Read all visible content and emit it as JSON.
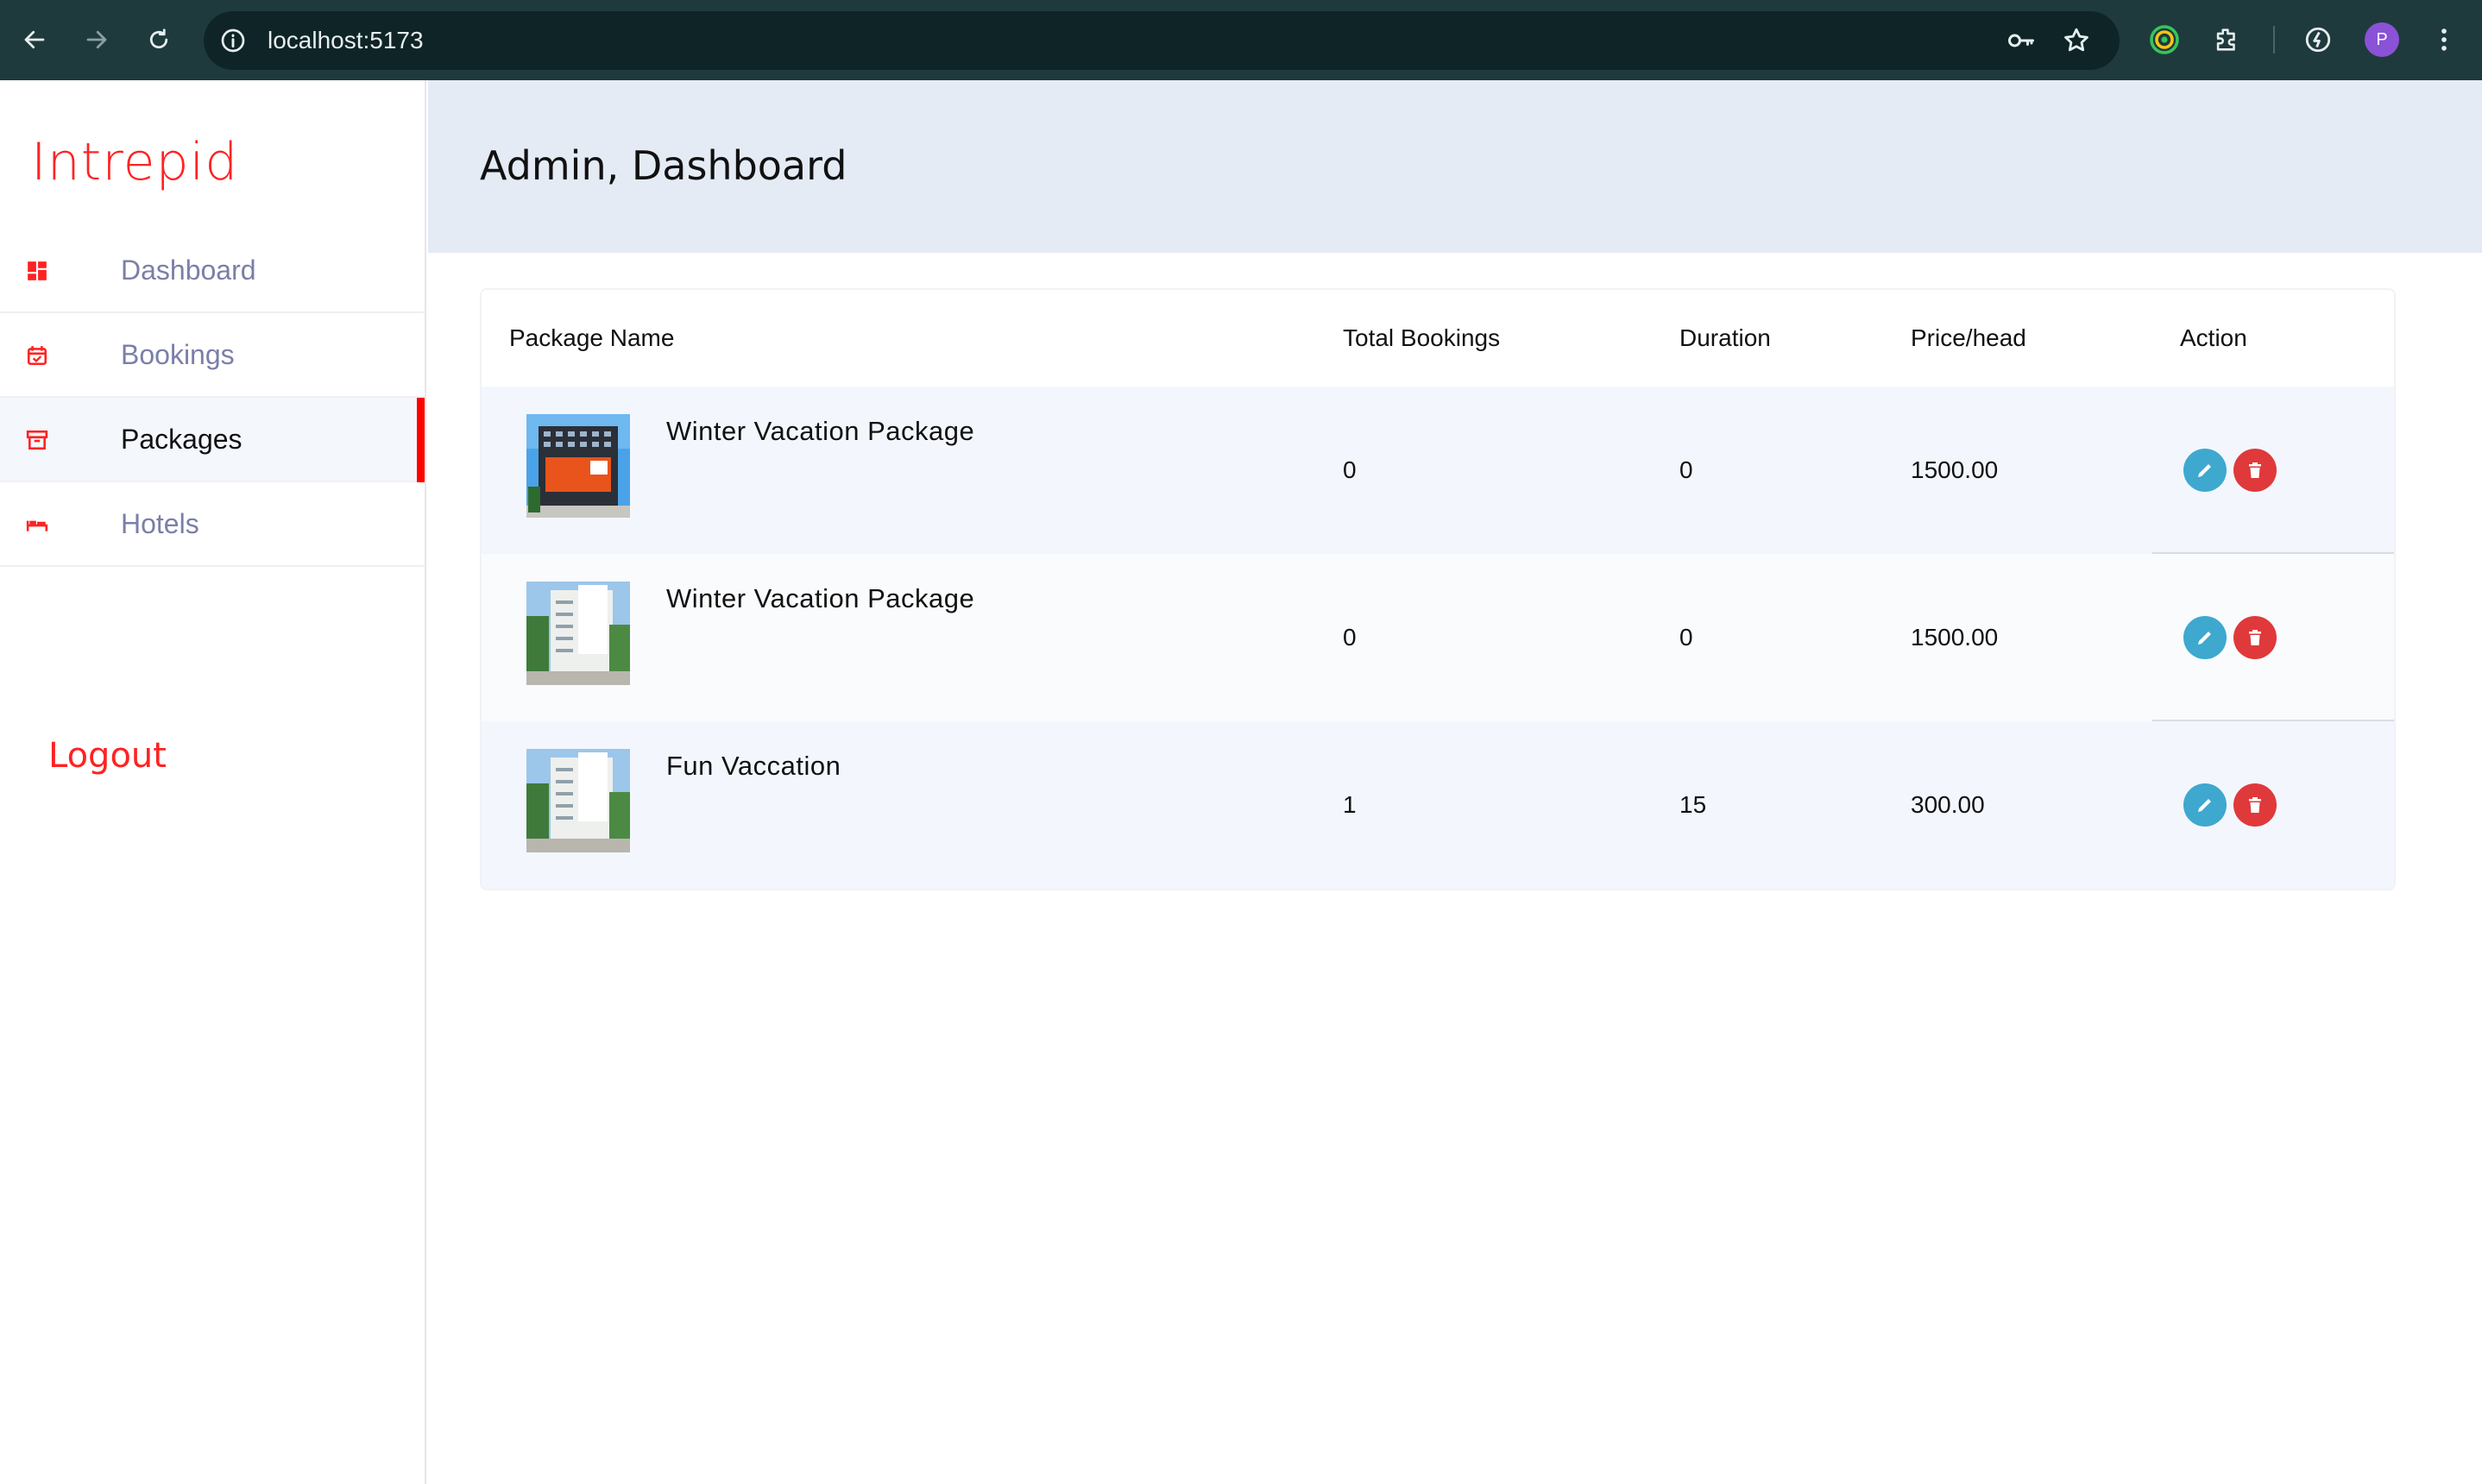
{
  "browser": {
    "url": "localhost:5173",
    "profile_initial": "P"
  },
  "sidebar": {
    "brand": "Intrepid",
    "items": [
      {
        "label": "Dashboard",
        "icon": "dashboard-icon",
        "active": false
      },
      {
        "label": "Bookings",
        "icon": "calendar-check-icon",
        "active": false
      },
      {
        "label": "Packages",
        "icon": "archive-box-icon",
        "active": true
      },
      {
        "label": "Hotels",
        "icon": "bed-icon",
        "active": false
      }
    ],
    "logout_label": "Logout",
    "accent_color": "#ff2222"
  },
  "header": {
    "title": "Admin, Dashboard"
  },
  "table": {
    "columns": [
      "Package Name",
      "Total Bookings",
      "Duration",
      "Price/head",
      "Action"
    ],
    "rows": [
      {
        "name": "Winter Vacation Package",
        "bookings": "0",
        "duration": "0",
        "price": "1500.00",
        "thumb": "orange-hotel-building"
      },
      {
        "name": "Winter Vacation Package",
        "bookings": "0",
        "duration": "0",
        "price": "1500.00",
        "thumb": "white-hotel-building"
      },
      {
        "name": "Fun Vaccation",
        "bookings": "1",
        "duration": "15",
        "price": "300.00",
        "thumb": "white-hotel-building"
      }
    ],
    "edit_color": "#3ea8cf",
    "delete_color": "#e0393b"
  }
}
